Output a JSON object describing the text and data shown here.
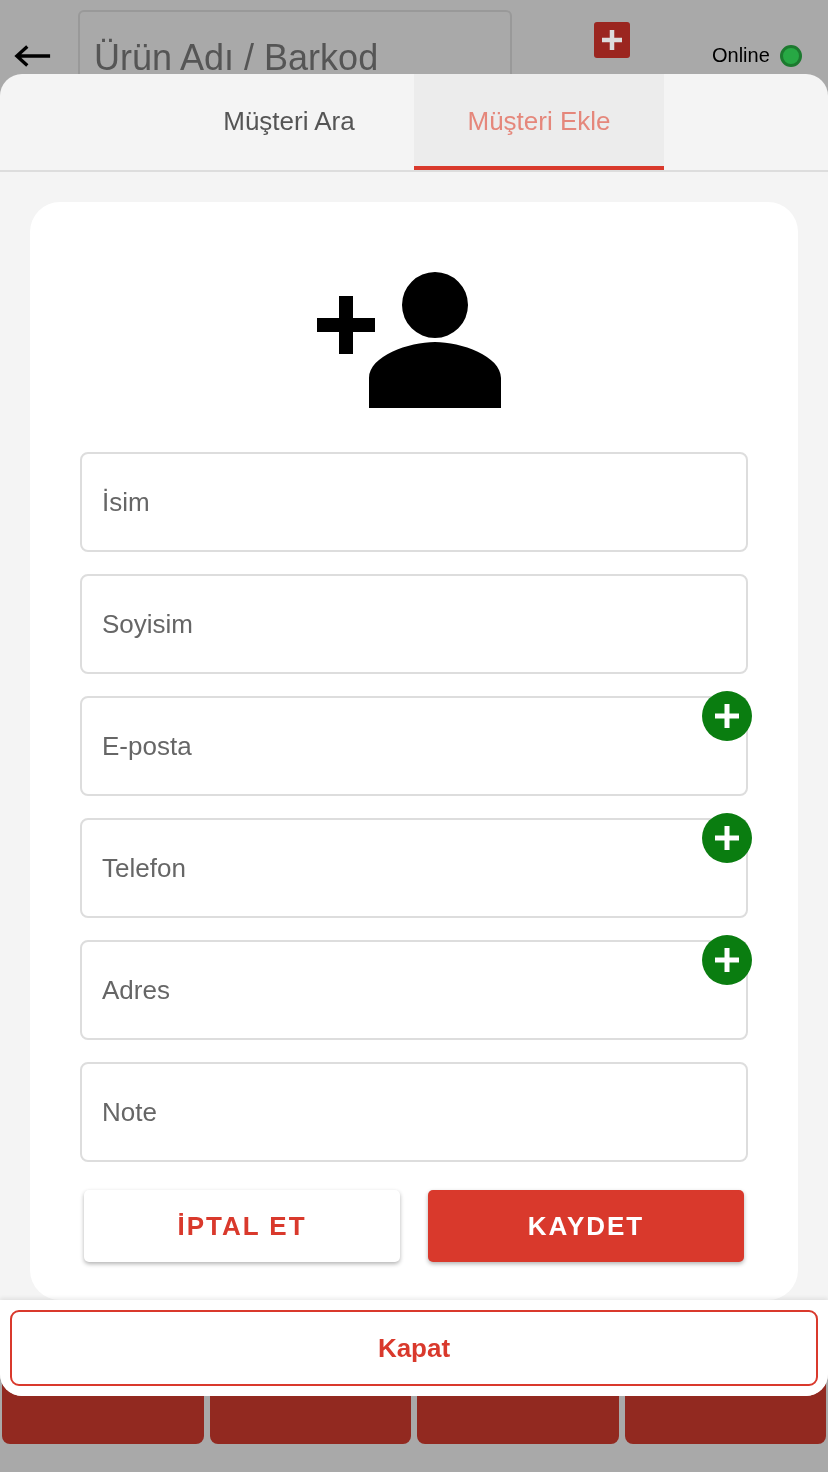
{
  "header": {
    "search": {
      "placeholder": "Ürün Adı / Barkod"
    },
    "status": {
      "label": "Online",
      "online": true
    }
  },
  "payment_buttons": [
    {
      "kind": "payment"
    },
    {
      "kind": "payment"
    },
    {
      "kind": "payment"
    },
    {
      "kind": "payment"
    }
  ],
  "tabs": [
    {
      "label": "Müşteri Ara",
      "selected": false
    },
    {
      "label": "Müşteri Ekle",
      "selected": true
    }
  ],
  "fields": [
    {
      "placeholder": "İsim",
      "addable": false
    },
    {
      "placeholder": "Soyisim",
      "addable": false
    },
    {
      "placeholder": "E-posta",
      "addable": true
    },
    {
      "placeholder": "Telefon",
      "addable": true
    },
    {
      "placeholder": "Adres",
      "addable": true
    },
    {
      "placeholder": "Note",
      "addable": false
    }
  ],
  "buttons": [
    {
      "label": "İPTAL ET",
      "kind": "secondary"
    },
    {
      "label": "KAYDET",
      "kind": "primary"
    }
  ],
  "close_button": {
    "label": "Kapat"
  }
}
